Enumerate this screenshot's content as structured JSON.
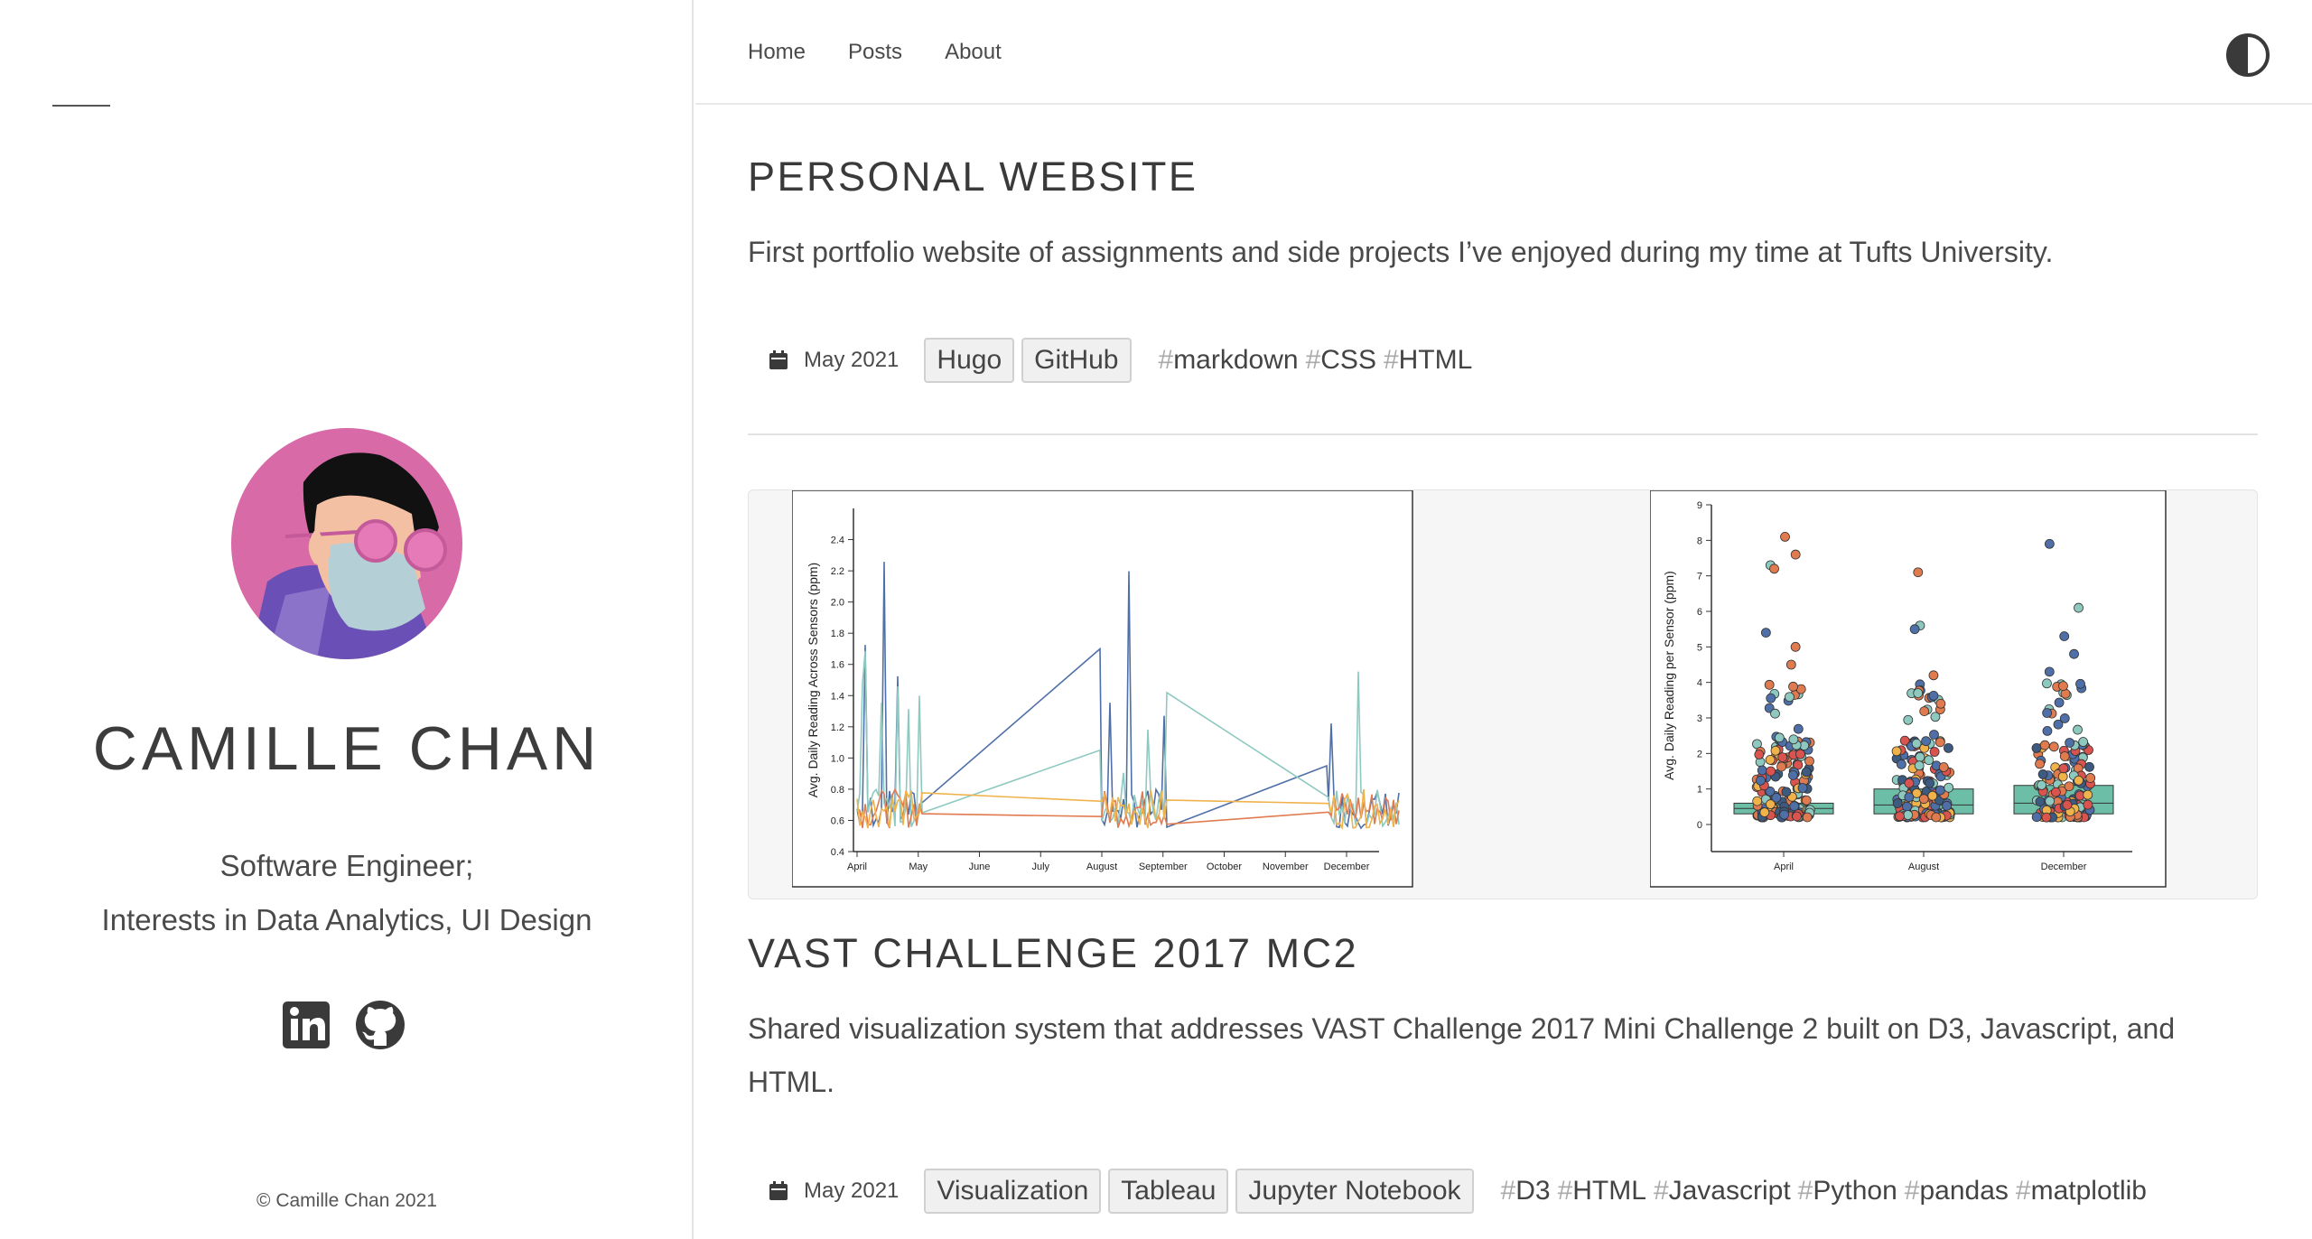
{
  "sidebar": {
    "name": "CAMILLE CHAN",
    "subtitle_line1": "Software Engineer;",
    "subtitle_line2": "Interests in Data Analytics, UI Design",
    "copyright": "© Camille Chan 2021"
  },
  "nav": {
    "items": [
      "Home",
      "Posts",
      "About"
    ]
  },
  "posts": [
    {
      "title": "PERSONAL WEBSITE",
      "description": "First portfolio website of assignments and side projects I’ve enjoyed during my time at Tufts University.",
      "date": "May 2021",
      "categories": [
        "Hugo",
        "GitHub"
      ],
      "tags": [
        "markdown",
        "CSS",
        "HTML"
      ]
    },
    {
      "title": "VAST CHALLENGE 2017 MC2",
      "description": "Shared visualization system that addresses VAST Challenge 2017 Mini Challenge 2 built on D3, Javascript, and HTML.",
      "date": "May 2021",
      "categories": [
        "Visualization",
        "Tableau",
        "Jupyter Notebook"
      ],
      "tags": [
        "D3",
        "HTML",
        "Javascript",
        "Python",
        "pandas",
        "matplotlib"
      ]
    }
  ],
  "chart_data": [
    {
      "type": "line",
      "ylabel": "Avg. Daily Reading Across Sensors (ppm)",
      "x_ticks": [
        "April",
        "May",
        "June",
        "July",
        "August",
        "September",
        "October",
        "November",
        "December"
      ],
      "y_ticks": [
        "0.4",
        "0.6",
        "0.8",
        "1.0",
        "1.2",
        "1.4",
        "1.6",
        "1.8",
        "2.0",
        "2.2",
        "2.4"
      ],
      "ylim": [
        0.4,
        2.6
      ],
      "series_colors": [
        "#4f6fa8",
        "#8ec9c0",
        "#e07b50",
        "#f0b24a"
      ]
    },
    {
      "type": "scatter",
      "ylabel": "Avg. Daily Reading per Sensor (ppm)",
      "categories": [
        "April",
        "August",
        "December"
      ],
      "y_ticks": [
        "0",
        "1",
        "2",
        "3",
        "4",
        "5",
        "6",
        "7",
        "8",
        "9"
      ],
      "ylim": [
        0,
        9
      ],
      "box_color": "#6cbfa6"
    }
  ]
}
